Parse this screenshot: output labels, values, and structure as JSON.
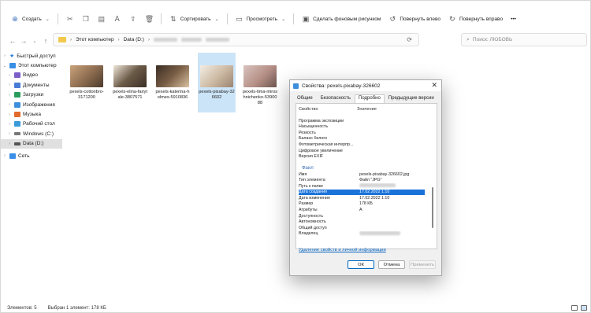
{
  "toolbar": {
    "create_label": "Создать",
    "sort_label": "Сортировать",
    "view_label": "Просмотреть",
    "wallpaper_label": "Сделать фоновым рисунком",
    "rotate_left_label": "Повернуть влево",
    "rotate_right_label": "Повернуть вправо",
    "more_label": "•••"
  },
  "address": {
    "breadcrumb_1": "Этот компьютер",
    "breadcrumb_2": "Data (D:)",
    "search_placeholder": "Поиск: ЛЮБОВЬ"
  },
  "sidebar": {
    "items": [
      {
        "label": "Быстрый доступ",
        "icon": "star-icon",
        "color": "#2b7bd3"
      },
      {
        "label": "Этот компьютер",
        "icon": "computer-icon",
        "color": "#3a8ee6"
      },
      {
        "label": "Видео",
        "icon": "video-folder-icon",
        "color": "#7b5fc7"
      },
      {
        "label": "Документы",
        "icon": "documents-folder-icon",
        "color": "#4a7bd6"
      },
      {
        "label": "Загрузки",
        "icon": "downloads-folder-icon",
        "color": "#2a9d5c"
      },
      {
        "label": "Изображения",
        "icon": "pictures-folder-icon",
        "color": "#3d8fdc"
      },
      {
        "label": "Музыка",
        "icon": "music-folder-icon",
        "color": "#e26a2c"
      },
      {
        "label": "Рабочий стол",
        "icon": "desktop-folder-icon",
        "color": "#3a9ad9"
      },
      {
        "label": "Windows (C:)",
        "icon": "drive-icon",
        "color": "#777777"
      },
      {
        "label": "Data (D:)",
        "icon": "drive-icon",
        "color": "#555555"
      },
      {
        "label": "Сеть",
        "icon": "network-icon",
        "color": "#3a8ee6"
      }
    ]
  },
  "files": [
    {
      "name": "pexels-cottonbro-3171200",
      "thumb": "#8a6a4e"
    },
    {
      "name": "pexels-elina-fairytale-3807571",
      "thumb": "#6b5a48"
    },
    {
      "name": "pexels-katerina-holmes-5910836",
      "thumb": "#5e4a3a"
    },
    {
      "name": "pexels-pixabay-326602",
      "thumb": "#cbb8a1"
    },
    {
      "name": "pexels-tima-miroshnichenko-5390088",
      "thumb": "#b58f86"
    }
  ],
  "status": {
    "count": "Элементов: 5",
    "selected": "Выбран 1 элемент: 178 КБ"
  },
  "dialog": {
    "title": "Свойства: pexels-pixabay-326602",
    "tabs": [
      "Общие",
      "Безопасность",
      "Подробно",
      "Предыдущие версии"
    ],
    "col_property": "Свойство",
    "col_value": "Значение",
    "rows": [
      {
        "k": "Программа экспозиции",
        "v": ""
      },
      {
        "k": "Насыщенность",
        "v": ""
      },
      {
        "k": "Резкость",
        "v": ""
      },
      {
        "k": "Баланс белого",
        "v": ""
      },
      {
        "k": "Фотометрическая интерпр...",
        "v": ""
      },
      {
        "k": "Цифровое увеличение",
        "v": ""
      },
      {
        "k": "Версия EXIF",
        "v": ""
      },
      {
        "k": "",
        "v": ""
      },
      {
        "k": "Файл",
        "v": ""
      },
      {
        "k": "Имя",
        "v": "pexels-pixabay-326602.jpg"
      },
      {
        "k": "Тип элемента",
        "v": "Файл \"JPG\""
      },
      {
        "k": "Путь к папке",
        "v": ""
      },
      {
        "k": "Дата создания",
        "v": "17.02.2022 1:10"
      },
      {
        "k": "Дата изменения",
        "v": "17.02.2022 1:10"
      },
      {
        "k": "Размер",
        "v": "178 КБ"
      },
      {
        "k": "Атрибуты",
        "v": "A"
      },
      {
        "k": "Доступность",
        "v": ""
      },
      {
        "k": "Автономность",
        "v": ""
      },
      {
        "k": "Общий доступ",
        "v": ""
      },
      {
        "k": "Владелец",
        "v": ""
      }
    ],
    "remove_link": "Удаление свойств и личной информации",
    "ok_label": "ОК",
    "cancel_label": "Отмена",
    "apply_label": "Применить"
  }
}
